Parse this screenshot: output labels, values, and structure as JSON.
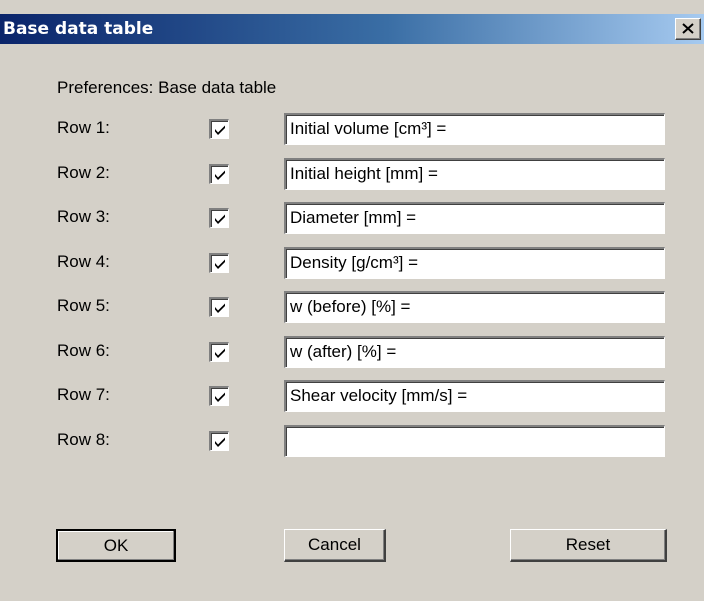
{
  "dialog": {
    "title": "Base data table",
    "heading": "Preferences: Base data table"
  },
  "rows": [
    {
      "label": "Row 1:",
      "checked": true,
      "value": "Initial volume [cm³] ="
    },
    {
      "label": "Row 2:",
      "checked": true,
      "value": "Initial height [mm] ="
    },
    {
      "label": "Row 3:",
      "checked": true,
      "value": "Diameter [mm] ="
    },
    {
      "label": "Row 4:",
      "checked": true,
      "value": "Density [g/cm³] ="
    },
    {
      "label": "Row 5:",
      "checked": true,
      "value": "w (before) [%] ="
    },
    {
      "label": "Row 6:",
      "checked": true,
      "value": "w (after) [%] ="
    },
    {
      "label": "Row 7:",
      "checked": true,
      "value": "Shear velocity [mm/s] ="
    },
    {
      "label": "Row 8:",
      "checked": true,
      "value": ""
    }
  ],
  "buttons": {
    "ok": "OK",
    "cancel": "Cancel",
    "reset": "Reset"
  },
  "icons": {
    "close": "close-icon",
    "check": "check-icon"
  },
  "colors": {
    "title_gradient_start": "#0a246a",
    "title_gradient_end": "#a6caf0",
    "face": "#d4d0c8"
  }
}
